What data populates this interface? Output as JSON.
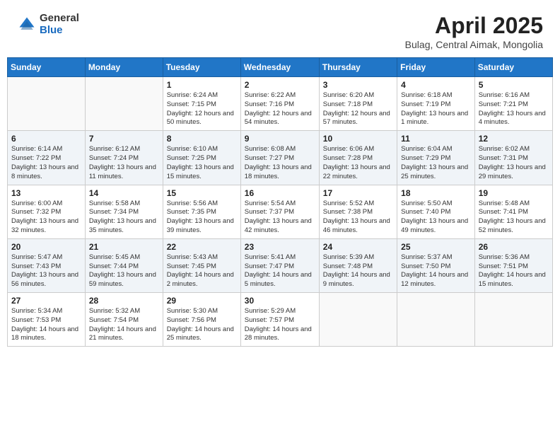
{
  "header": {
    "logo_general": "General",
    "logo_blue": "Blue",
    "month_title": "April 2025",
    "location": "Bulag, Central Aimak, Mongolia"
  },
  "days_of_week": [
    "Sunday",
    "Monday",
    "Tuesday",
    "Wednesday",
    "Thursday",
    "Friday",
    "Saturday"
  ],
  "weeks": [
    [
      {
        "day": "",
        "info": ""
      },
      {
        "day": "",
        "info": ""
      },
      {
        "day": "1",
        "info": "Sunrise: 6:24 AM\nSunset: 7:15 PM\nDaylight: 12 hours and 50 minutes."
      },
      {
        "day": "2",
        "info": "Sunrise: 6:22 AM\nSunset: 7:16 PM\nDaylight: 12 hours and 54 minutes."
      },
      {
        "day": "3",
        "info": "Sunrise: 6:20 AM\nSunset: 7:18 PM\nDaylight: 12 hours and 57 minutes."
      },
      {
        "day": "4",
        "info": "Sunrise: 6:18 AM\nSunset: 7:19 PM\nDaylight: 13 hours and 1 minute."
      },
      {
        "day": "5",
        "info": "Sunrise: 6:16 AM\nSunset: 7:21 PM\nDaylight: 13 hours and 4 minutes."
      }
    ],
    [
      {
        "day": "6",
        "info": "Sunrise: 6:14 AM\nSunset: 7:22 PM\nDaylight: 13 hours and 8 minutes."
      },
      {
        "day": "7",
        "info": "Sunrise: 6:12 AM\nSunset: 7:24 PM\nDaylight: 13 hours and 11 minutes."
      },
      {
        "day": "8",
        "info": "Sunrise: 6:10 AM\nSunset: 7:25 PM\nDaylight: 13 hours and 15 minutes."
      },
      {
        "day": "9",
        "info": "Sunrise: 6:08 AM\nSunset: 7:27 PM\nDaylight: 13 hours and 18 minutes."
      },
      {
        "day": "10",
        "info": "Sunrise: 6:06 AM\nSunset: 7:28 PM\nDaylight: 13 hours and 22 minutes."
      },
      {
        "day": "11",
        "info": "Sunrise: 6:04 AM\nSunset: 7:29 PM\nDaylight: 13 hours and 25 minutes."
      },
      {
        "day": "12",
        "info": "Sunrise: 6:02 AM\nSunset: 7:31 PM\nDaylight: 13 hours and 29 minutes."
      }
    ],
    [
      {
        "day": "13",
        "info": "Sunrise: 6:00 AM\nSunset: 7:32 PM\nDaylight: 13 hours and 32 minutes."
      },
      {
        "day": "14",
        "info": "Sunrise: 5:58 AM\nSunset: 7:34 PM\nDaylight: 13 hours and 35 minutes."
      },
      {
        "day": "15",
        "info": "Sunrise: 5:56 AM\nSunset: 7:35 PM\nDaylight: 13 hours and 39 minutes."
      },
      {
        "day": "16",
        "info": "Sunrise: 5:54 AM\nSunset: 7:37 PM\nDaylight: 13 hours and 42 minutes."
      },
      {
        "day": "17",
        "info": "Sunrise: 5:52 AM\nSunset: 7:38 PM\nDaylight: 13 hours and 46 minutes."
      },
      {
        "day": "18",
        "info": "Sunrise: 5:50 AM\nSunset: 7:40 PM\nDaylight: 13 hours and 49 minutes."
      },
      {
        "day": "19",
        "info": "Sunrise: 5:48 AM\nSunset: 7:41 PM\nDaylight: 13 hours and 52 minutes."
      }
    ],
    [
      {
        "day": "20",
        "info": "Sunrise: 5:47 AM\nSunset: 7:43 PM\nDaylight: 13 hours and 56 minutes."
      },
      {
        "day": "21",
        "info": "Sunrise: 5:45 AM\nSunset: 7:44 PM\nDaylight: 13 hours and 59 minutes."
      },
      {
        "day": "22",
        "info": "Sunrise: 5:43 AM\nSunset: 7:45 PM\nDaylight: 14 hours and 2 minutes."
      },
      {
        "day": "23",
        "info": "Sunrise: 5:41 AM\nSunset: 7:47 PM\nDaylight: 14 hours and 5 minutes."
      },
      {
        "day": "24",
        "info": "Sunrise: 5:39 AM\nSunset: 7:48 PM\nDaylight: 14 hours and 9 minutes."
      },
      {
        "day": "25",
        "info": "Sunrise: 5:37 AM\nSunset: 7:50 PM\nDaylight: 14 hours and 12 minutes."
      },
      {
        "day": "26",
        "info": "Sunrise: 5:36 AM\nSunset: 7:51 PM\nDaylight: 14 hours and 15 minutes."
      }
    ],
    [
      {
        "day": "27",
        "info": "Sunrise: 5:34 AM\nSunset: 7:53 PM\nDaylight: 14 hours and 18 minutes."
      },
      {
        "day": "28",
        "info": "Sunrise: 5:32 AM\nSunset: 7:54 PM\nDaylight: 14 hours and 21 minutes."
      },
      {
        "day": "29",
        "info": "Sunrise: 5:30 AM\nSunset: 7:56 PM\nDaylight: 14 hours and 25 minutes."
      },
      {
        "day": "30",
        "info": "Sunrise: 5:29 AM\nSunset: 7:57 PM\nDaylight: 14 hours and 28 minutes."
      },
      {
        "day": "",
        "info": ""
      },
      {
        "day": "",
        "info": ""
      },
      {
        "day": "",
        "info": ""
      }
    ]
  ]
}
